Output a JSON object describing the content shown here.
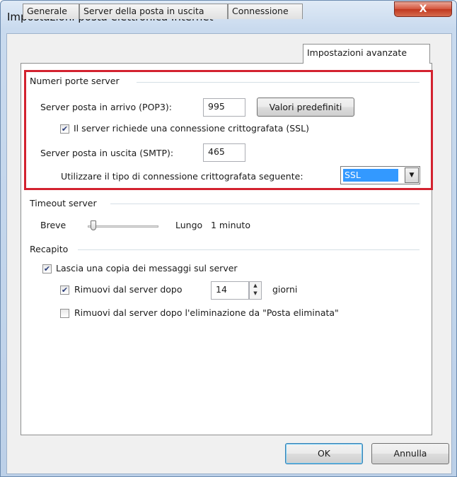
{
  "window": {
    "title": "Impostazioni posta elettronica Internet",
    "close_glyph": "X"
  },
  "tabs": [
    "Generale",
    "Server della posta in uscita",
    "Connessione",
    "Impostazioni avanzate"
  ],
  "ports_group": {
    "title": "Numeri porte server",
    "incoming_label": "Server posta in arrivo (POP3):",
    "incoming_value": "995",
    "defaults_button": "Valori predefiniti",
    "ssl_checkbox_label": "Il server richiede una connessione crittografata (SSL)",
    "ssl_checked": true,
    "outgoing_label": "Server posta in uscita (SMTP):",
    "outgoing_value": "465",
    "encryption_label": "Utilizzare il tipo di connessione crittografata seguente:",
    "encryption_value": "SSL"
  },
  "timeout_group": {
    "title": "Timeout server",
    "short_label": "Breve",
    "long_label": "Lungo",
    "value_text": "1 minuto"
  },
  "delivery_group": {
    "title": "Recapito",
    "leave_copy_label": "Lascia una copia dei messaggi sul server",
    "leave_copy_checked": true,
    "remove_after_label": "Rimuovi dal server dopo",
    "remove_after_checked": true,
    "days_value": "14",
    "days_unit": "giorni",
    "remove_deleted_label": "Rimuovi dal server dopo l'eliminazione da \"Posta eliminata\"",
    "remove_deleted_checked": false
  },
  "footer": {
    "ok_label": "OK",
    "cancel_label": "Annulla"
  },
  "colors": {
    "highlight_border": "#d3222f",
    "selection": "#3399ff",
    "close_button": "#c0381f"
  }
}
